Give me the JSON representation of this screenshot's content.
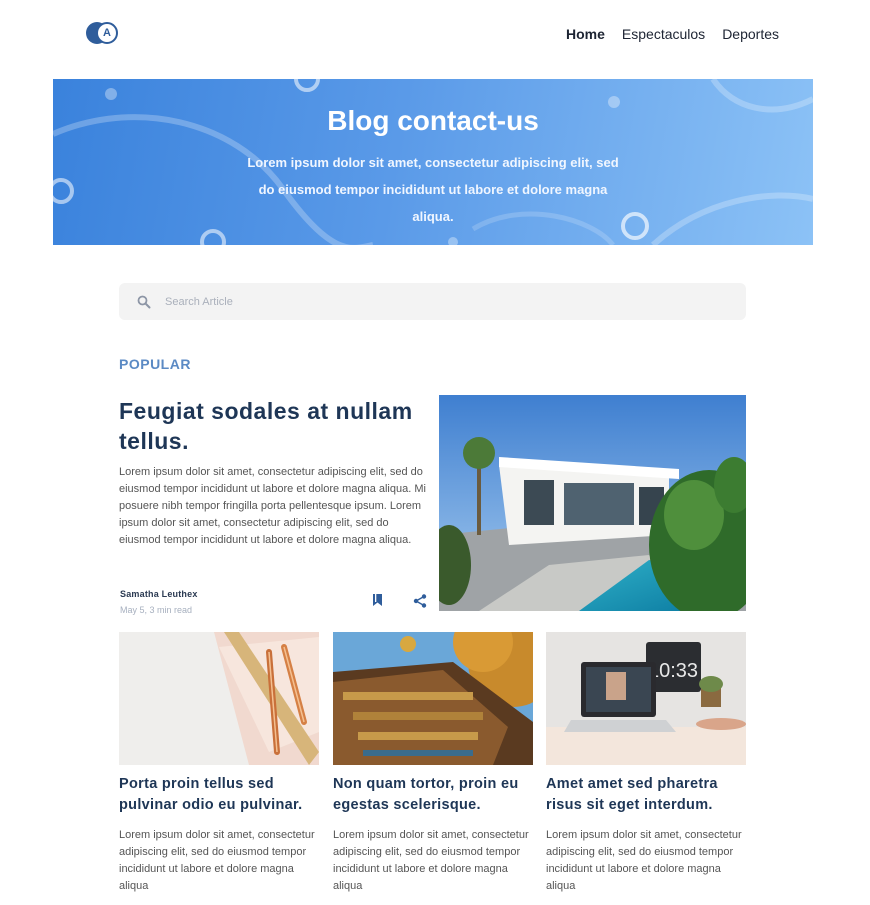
{
  "brand": {
    "logo_letter": "A"
  },
  "nav": {
    "items": [
      {
        "label": "Home",
        "active": true
      },
      {
        "label": "Espectaculos",
        "active": false
      },
      {
        "label": "Deportes",
        "active": false
      }
    ]
  },
  "hero": {
    "title": "Blog contact-us",
    "subtitle": "Lorem ipsum dolor sit amet, consectetur adipiscing elit, sed do eiusmod tempor incididunt ut labore et dolore magna aliqua."
  },
  "search": {
    "placeholder": "Search Article",
    "icon": "search-icon"
  },
  "section": {
    "label": "POPULAR"
  },
  "featured": {
    "title": "Feugiat sodales at nullam tellus.",
    "text": "Lorem ipsum dolor sit amet, consectetur adipiscing elit, sed do eiusmod tempor incididunt ut labore et dolore magna aliqua. Mi posuere nibh tempor fringilla porta pellentesque ipsum. Lorem ipsum dolor sit amet, consectetur adipiscing elit, sed do eiusmod tempor incididunt ut labore et dolore magna aliqua.",
    "author": "Samatha Leuthex",
    "meta": "May 5, 3 min read",
    "image": "modern-house-pool-photo"
  },
  "cards": [
    {
      "title": "Porta proin tellus sed pulvinar odio eu pulvinar.",
      "text": "Lorem ipsum dolor sit amet, consectetur adipiscing elit, sed do eiusmod tempor incididunt ut labore et dolore magna aliqua",
      "image": "pens-and-paper-photo"
    },
    {
      "title": "Non quam tortor, proin eu egestas scelerisque.",
      "text": "Lorem ipsum dolor sit amet, consectetur adipiscing elit, sed do eiusmod tempor incididunt ut labore et dolore magna aliqua",
      "image": "temple-roof-photo"
    },
    {
      "title": "Amet amet sed pharetra risus sit eget interdum.",
      "text": "Lorem ipsum dolor sit amet, consectetur adipiscing elit, sed do eiusmod tempor incididunt ut labore et dolore magna aliqua",
      "image": "laptop-desk-photo"
    }
  ],
  "colors": {
    "brand": "#2f5d9b",
    "heading": "#1e3656",
    "accent": "#5b8ac4",
    "hero_start": "#3a82dc",
    "hero_end": "#8cc2f6"
  }
}
